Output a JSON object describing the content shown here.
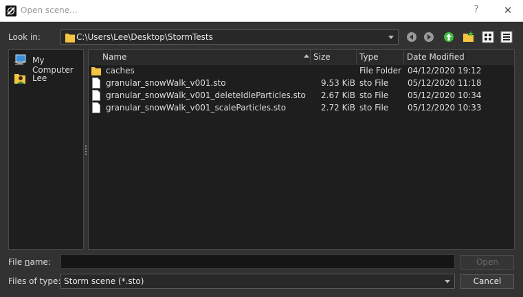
{
  "window": {
    "title": "Open scene...",
    "help": "?",
    "close": "✕"
  },
  "lookin": {
    "label": "Look in:",
    "path": "C:\\Users\\Lee\\Desktop\\StormTests"
  },
  "toolbar": {
    "icons": [
      "back-icon",
      "forward-icon",
      "up-icon",
      "new-folder-icon",
      "list-view-icon",
      "detail-view-icon"
    ]
  },
  "sidebar": {
    "items": [
      {
        "label": "My Computer",
        "icon": "computer-icon"
      },
      {
        "label": "Lee",
        "icon": "user-icon"
      }
    ]
  },
  "list": {
    "columns": [
      "Name",
      "Size",
      "Type",
      "Date Modified"
    ],
    "rows": [
      {
        "name": "caches",
        "size": "",
        "type": "File Folder",
        "date": "04/12/2020 19:12",
        "icon": "folder-icon"
      },
      {
        "name": "granular_snowWalk_v001.sto",
        "size": "9.53 KiB",
        "type": "sto File",
        "date": "05/12/2020 11:18",
        "icon": "file-icon"
      },
      {
        "name": "granular_snowWalk_v001_deleteIdleParticles.sto",
        "size": "2.67 KiB",
        "type": "sto File",
        "date": "05/12/2020 10:34",
        "icon": "file-icon"
      },
      {
        "name": "granular_snowWalk_v001_scaleParticles.sto",
        "size": "2.72 KiB",
        "type": "sto File",
        "date": "05/12/2020 10:33",
        "icon": "file-icon"
      }
    ]
  },
  "filename": {
    "label_pre": "File ",
    "label_ul": "n",
    "label_post": "ame:",
    "value": ""
  },
  "filetype": {
    "label": "Files of type:",
    "value": "Storm scene (*.sto)"
  },
  "buttons": {
    "open": "Open",
    "cancel": "Cancel"
  },
  "colors": {
    "folder": "#f5c542",
    "accent_green": "#3fbf3f",
    "background": "#323232"
  }
}
